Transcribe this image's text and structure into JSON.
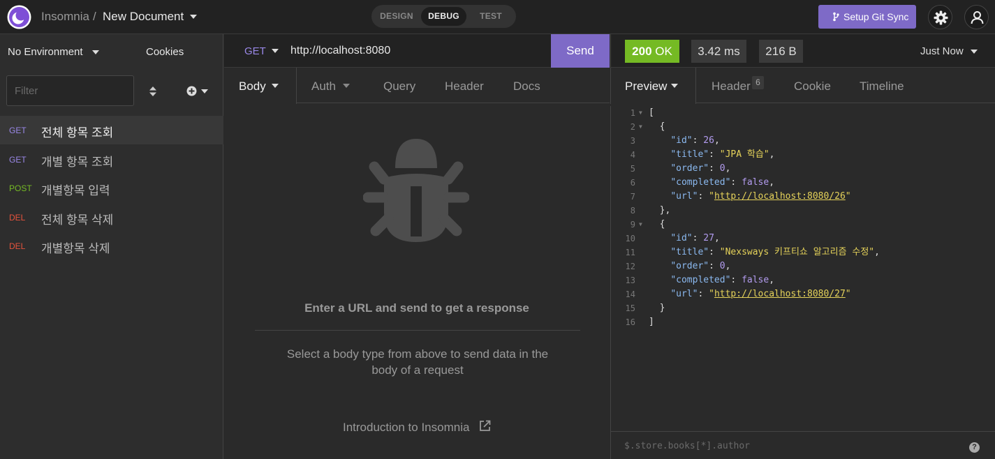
{
  "app": {
    "name": "Insomnia",
    "separator": "/",
    "document": "New Document"
  },
  "modes": {
    "design": "DESIGN",
    "debug": "DEBUG",
    "test": "TEST"
  },
  "toolbar": {
    "git_sync": "Setup Git Sync"
  },
  "sidebar": {
    "environment": "No Environment",
    "cookies": "Cookies",
    "filter_placeholder": "Filter",
    "requests": [
      {
        "method": "GET",
        "name": "전체 항목 조회",
        "color": "#9a88e8",
        "active": true
      },
      {
        "method": "GET",
        "name": "개별 항목 조회",
        "color": "#9a88e8",
        "active": false
      },
      {
        "method": "POST",
        "name": "개별항목 입력",
        "color": "#75ba24",
        "active": false
      },
      {
        "method": "DEL",
        "name": "전체 항목 삭제",
        "color": "#e5533d",
        "active": false
      },
      {
        "method": "DEL",
        "name": "개별항목 삭제",
        "color": "#e5533d",
        "active": false
      }
    ]
  },
  "request": {
    "method": "GET",
    "url": "http://localhost:8080",
    "send_label": "Send",
    "tabs": {
      "body": "Body",
      "auth": "Auth",
      "query": "Query",
      "header": "Header",
      "docs": "Docs"
    },
    "empty_heading": "Enter a URL and send to get a response",
    "empty_hint": "Select a body type from above to send data in the body of a request",
    "intro_link": "Introduction to Insomnia"
  },
  "response": {
    "status_code": "200",
    "status_text": "OK",
    "time": "3.42 ms",
    "size": "216 B",
    "timestamp": "Just Now",
    "tabs": {
      "preview": "Preview",
      "header": "Header",
      "header_count": "6",
      "cookie": "Cookie",
      "timeline": "Timeline"
    },
    "filter_placeholder": "$.store.books[*].author",
    "help": "?",
    "body_lines": [
      "[",
      "  {",
      "    \"id\": 26,",
      "    \"title\": \"JPA 학습\",",
      "    \"order\": 0,",
      "    \"completed\": false,",
      "    \"url\": \"http://localhost:8080/26\"",
      "  },",
      "  {",
      "    \"id\": 27,",
      "    \"title\": \"Nexsways 키프티쇼 알고리즘 수정\",",
      "    \"order\": 0,",
      "    \"completed\": false,",
      "    \"url\": \"http://localhost:8080/27\"",
      "  }",
      "]"
    ],
    "foldable_lines": [
      1,
      2,
      9
    ]
  },
  "colors": {
    "accent": "#7e6ac7",
    "status_ok": "#75ba24",
    "method_get": "#9a88e8",
    "method_post": "#75ba24",
    "method_del": "#e5533d"
  }
}
